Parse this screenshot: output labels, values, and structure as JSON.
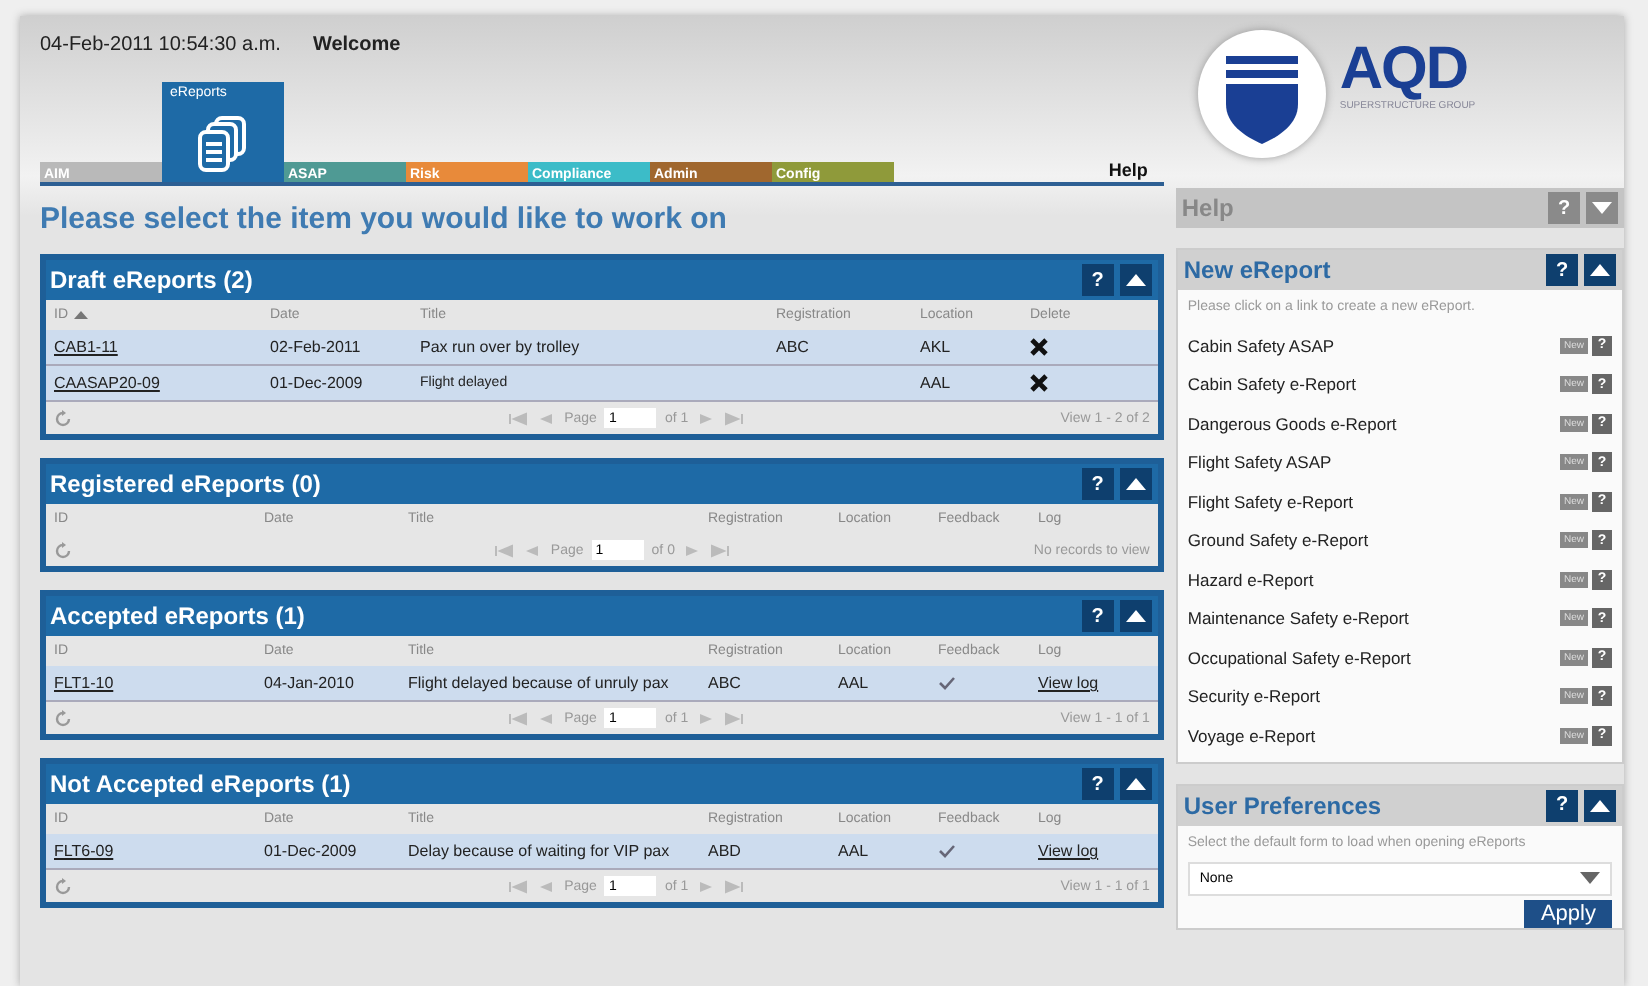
{
  "header": {
    "datetime": "04-Feb-2011 10:54:30 a.m.",
    "welcome": "Welcome",
    "help_link": "Help"
  },
  "tabs": [
    {
      "label": "AIM",
      "selected": false,
      "color": "#b9b9b9"
    },
    {
      "label": "eReports",
      "selected": true,
      "color": "#1e6aa6"
    },
    {
      "label": "ASAP",
      "selected": false,
      "color": "#4f9a94"
    },
    {
      "label": "Risk",
      "selected": false,
      "color": "#e88a3a"
    },
    {
      "label": "Compliance",
      "selected": false,
      "color": "#3cbcc8"
    },
    {
      "label": "Admin",
      "selected": false,
      "color": "#a0672e"
    },
    {
      "label": "Config",
      "selected": false,
      "color": "#8f9a3a"
    }
  ],
  "logo": {
    "name": "AQD",
    "tagline": "SUPERSTRUCTURE GROUP"
  },
  "heading": "Please select the item you would like to work on",
  "panels": [
    {
      "title": "Draft eReports (2)",
      "help_button": "?",
      "columns": [
        {
          "label": "ID",
          "kind": "id",
          "sorted": true
        },
        {
          "label": "Date",
          "kind": "date"
        },
        {
          "label": "Title",
          "kind": "title"
        },
        {
          "label": "Registration",
          "kind": "registration"
        },
        {
          "label": "Location",
          "kind": "location"
        },
        {
          "label": "Delete",
          "kind": "delete"
        }
      ],
      "rows": [
        {
          "id": "CAB1-11",
          "date": "02-Feb-2011",
          "title": "Pax run over by trolley",
          "registration": "ABC",
          "location": "AKL"
        },
        {
          "id": "CAASAP20-09",
          "date": "01-Dec-2009",
          "title": "Flight delayed",
          "registration": "",
          "location": "AAL"
        }
      ],
      "pager": {
        "label": "Page",
        "page": "1",
        "of": "of 1",
        "info": "View 1 - 2 of 2"
      }
    },
    {
      "title": "Registered eReports (0)",
      "help_button": "?",
      "columns": [
        {
          "label": "ID",
          "kind": "id",
          "sorted": false
        },
        {
          "label": "Date",
          "kind": "date"
        },
        {
          "label": "Title",
          "kind": "title"
        },
        {
          "label": "Registration",
          "kind": "registration"
        },
        {
          "label": "Location",
          "kind": "location"
        },
        {
          "label": "Feedback",
          "kind": "feedback"
        },
        {
          "label": "Log",
          "kind": "log"
        }
      ],
      "pager": {
        "label": "Page",
        "page": "1",
        "of": "of 0",
        "info": "No records to view"
      }
    },
    {
      "title": "Accepted eReports (1)",
      "help_button": "?",
      "columns": [
        {
          "label": "ID",
          "kind": "id",
          "sorted": false
        },
        {
          "label": "Date",
          "kind": "date"
        },
        {
          "label": "Title",
          "kind": "title"
        },
        {
          "label": "Registration",
          "kind": "registration"
        },
        {
          "label": "Location",
          "kind": "location"
        },
        {
          "label": "Feedback",
          "kind": "feedback"
        },
        {
          "label": "Log",
          "kind": "log"
        }
      ],
      "rows": [
        {
          "id": "FLT1-10",
          "date": "04-Jan-2010",
          "title": "Flight delayed because of unruly pax",
          "registration": "ABC",
          "location": "AAL",
          "feedback": true,
          "log": "View log"
        }
      ],
      "pager": {
        "label": "Page",
        "page": "1",
        "of": "of 1",
        "info": "View 1 - 1 of 1"
      }
    },
    {
      "title": "Not Accepted eReports (1)",
      "help_button": "?",
      "columns": [
        {
          "label": "ID",
          "kind": "id",
          "sorted": false
        },
        {
          "label": "Date",
          "kind": "date"
        },
        {
          "label": "Title",
          "kind": "title"
        },
        {
          "label": "Registration",
          "kind": "registration"
        },
        {
          "label": "Location",
          "kind": "location"
        },
        {
          "label": "Feedback",
          "kind": "feedback"
        },
        {
          "label": "Log",
          "kind": "log"
        }
      ],
      "rows": [
        {
          "id": "FLT6-09",
          "date": "01-Dec-2009",
          "title": "Delay because of waiting for VIP pax",
          "registration": "ABD",
          "location": "AAL",
          "feedback": true,
          "log": "View log"
        }
      ],
      "pager": {
        "label": "Page",
        "page": "1",
        "of": "of 1",
        "info": "View 1 - 1 of 1"
      }
    }
  ],
  "sidebar": {
    "help": {
      "title": "Help",
      "help_button": "?",
      "expanded": false
    },
    "new_ereport": {
      "title": "New eReport",
      "help_button": "?",
      "expanded": true,
      "hint": "Please click on a link to create a new eReport.",
      "items": [
        {
          "label": "Cabin Safety ASAP",
          "badge": "New",
          "help_button": "?"
        },
        {
          "label": "Cabin Safety e-Report",
          "badge": "New",
          "help_button": "?"
        },
        {
          "label": "Dangerous Goods e-Report",
          "badge": "New",
          "help_button": "?"
        },
        {
          "label": "Flight Safety ASAP",
          "badge": "New",
          "help_button": "?"
        },
        {
          "label": "Flight Safety e-Report",
          "badge": "New",
          "help_button": "?"
        },
        {
          "label": "Ground Safety e-Report",
          "badge": "New",
          "help_button": "?"
        },
        {
          "label": "Hazard e-Report",
          "badge": "New",
          "help_button": "?"
        },
        {
          "label": "Maintenance Safety e-Report",
          "badge": "New",
          "help_button": "?"
        },
        {
          "label": "Occupational Safety e-Report",
          "badge": "New",
          "help_button": "?"
        },
        {
          "label": "Security e-Report",
          "badge": "New",
          "help_button": "?"
        },
        {
          "label": "Voyage e-Report",
          "badge": "New",
          "help_button": "?"
        }
      ]
    },
    "user_preferences": {
      "title": "User Preferences",
      "help_button": "?",
      "expanded": true,
      "hint": "Select the default form to load when opening eReports",
      "select_value": "None",
      "apply": "Apply"
    }
  }
}
